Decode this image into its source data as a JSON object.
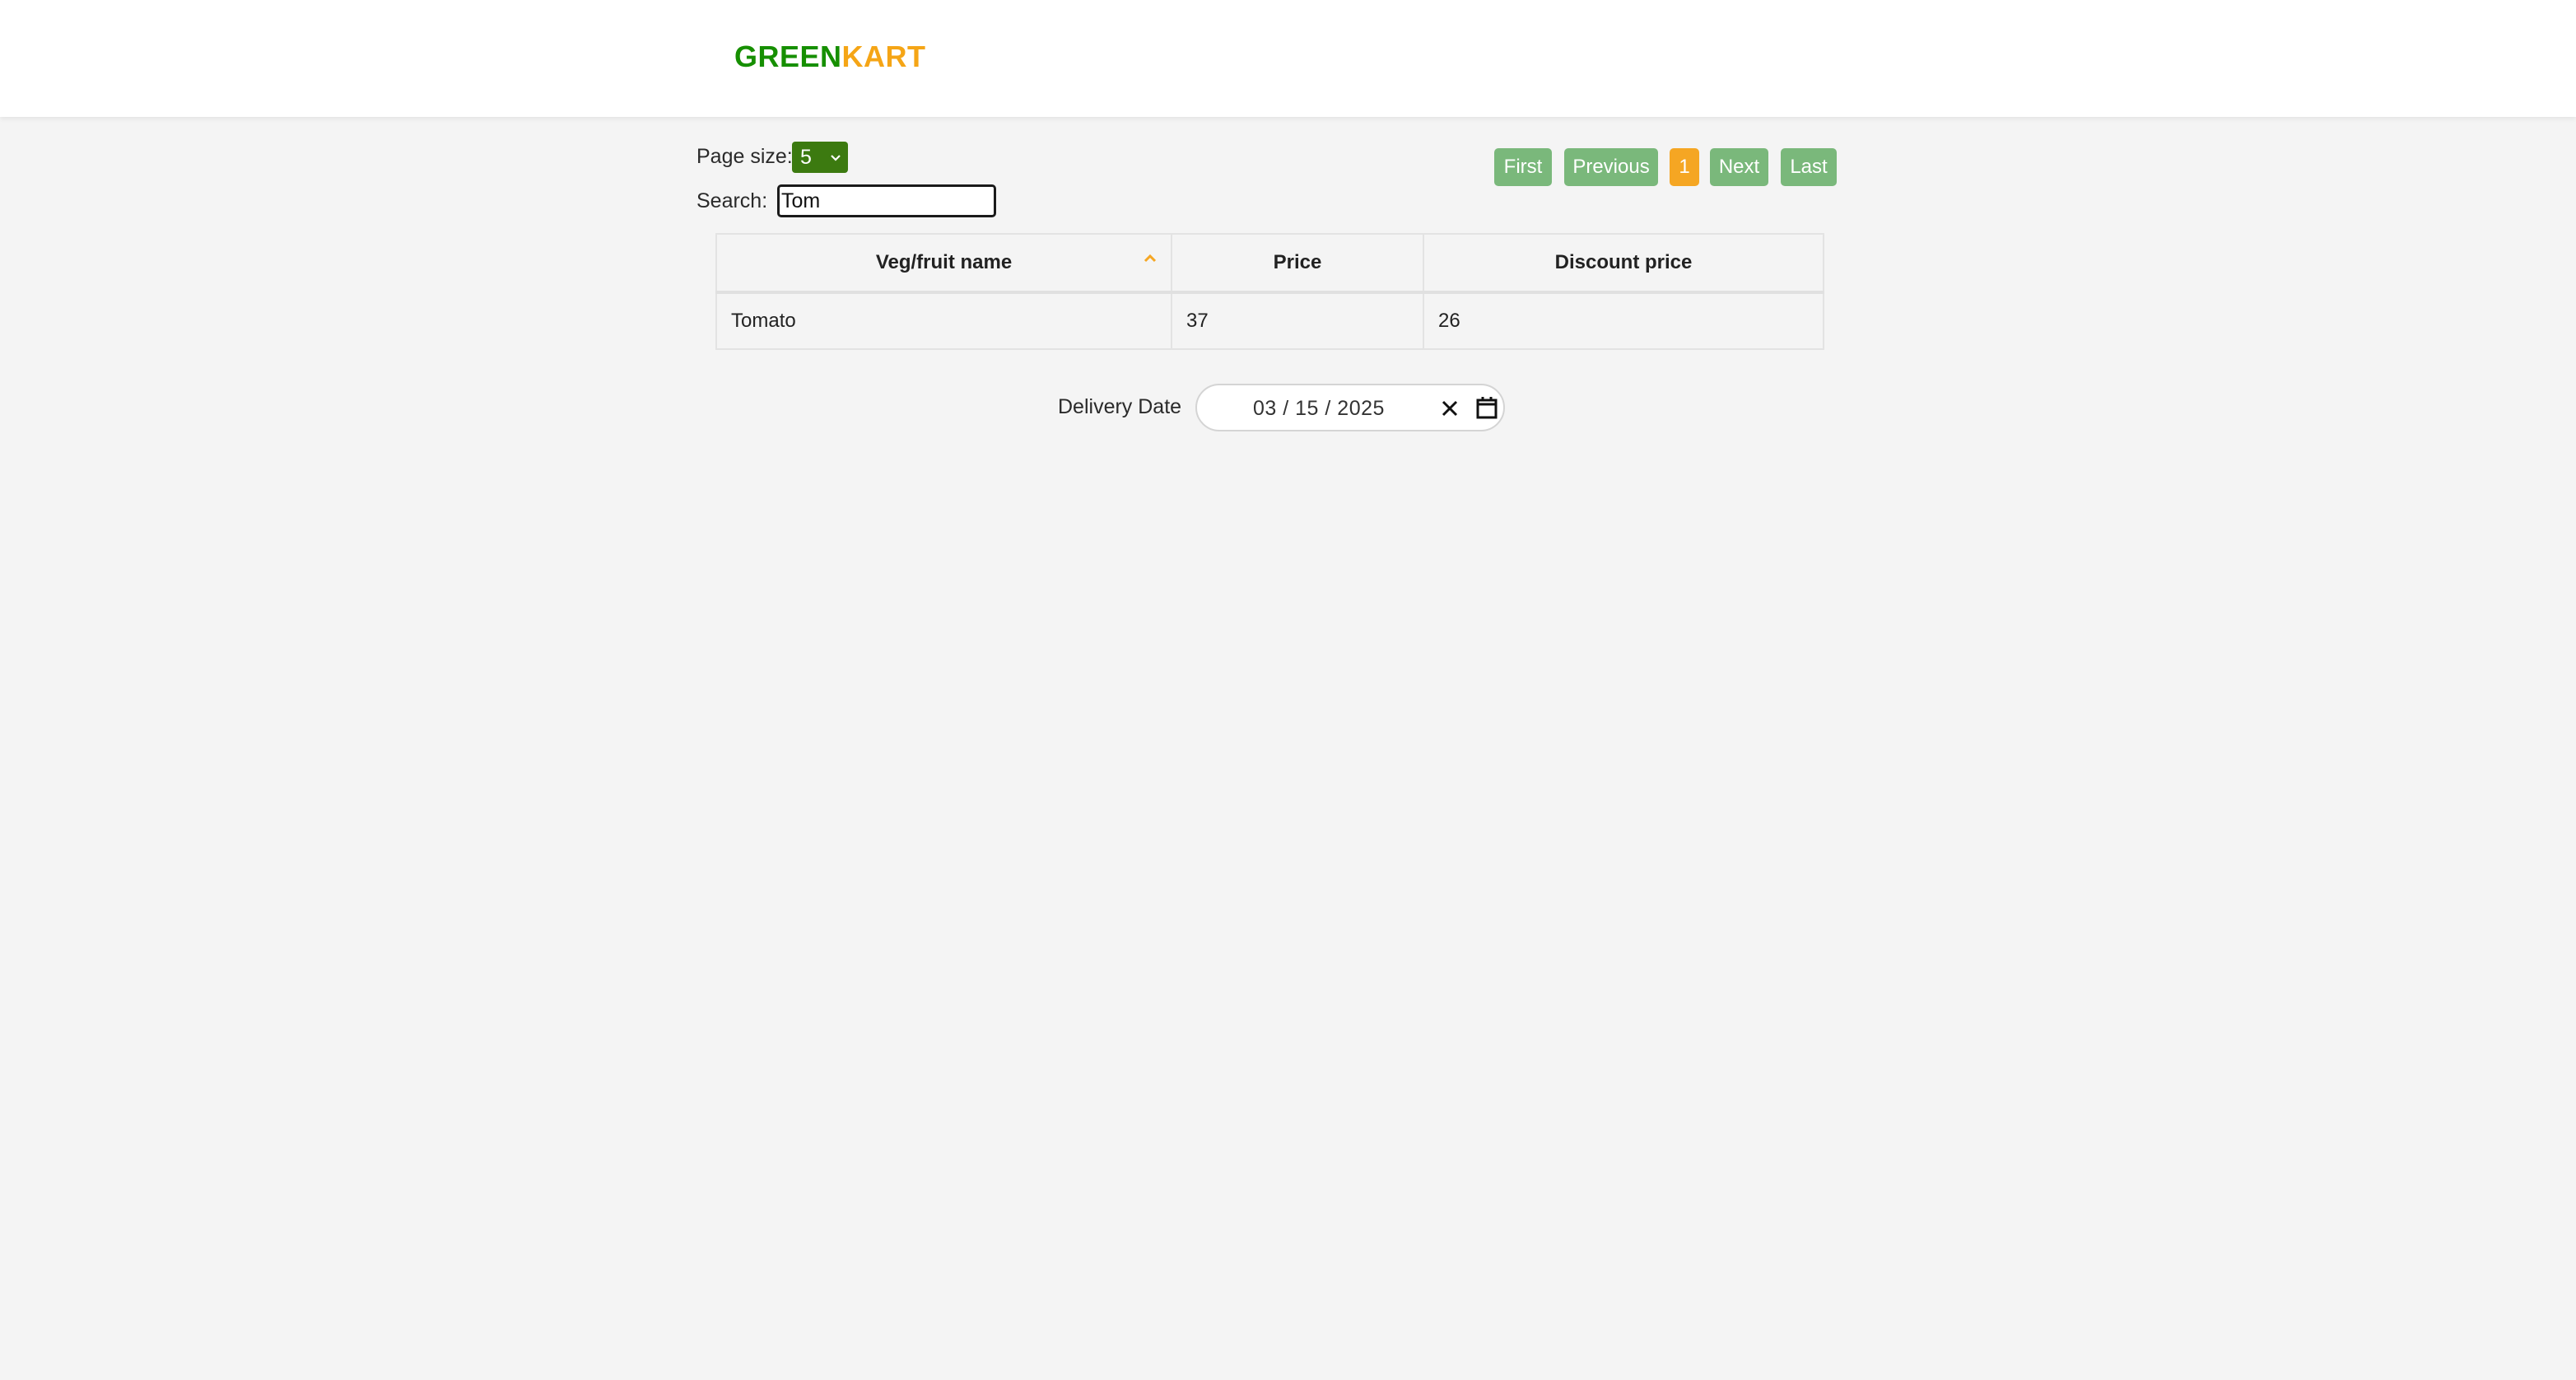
{
  "brand": {
    "part1": "GREEN",
    "part2": "KART"
  },
  "controls": {
    "page_size_label": "Page size:",
    "page_size_value": "5",
    "search_label": "Search:",
    "search_value": "Tom"
  },
  "pagination": {
    "first": "First",
    "previous": "Previous",
    "current": "1",
    "next": "Next",
    "last": "Last"
  },
  "table": {
    "headers": [
      "Veg/fruit name",
      "Price",
      "Discount price"
    ],
    "sort": "ascending on Veg/fruit name",
    "rows": [
      [
        "Tomato",
        "37",
        "26"
      ]
    ]
  },
  "delivery": {
    "label": "Delivery Date",
    "date": "03 / 15 / 2025"
  },
  "colors": {
    "brand_green": "#168f00",
    "brand_orange": "#f5a516",
    "pager_button": "#7ab87b",
    "pager_active": "#f5a623",
    "select_bg": "#3c7a10"
  },
  "icons": {
    "page_size_select": "chevron-down-icon",
    "sort_indicator": "chevron-up-icon",
    "date_clear": "close-icon",
    "date_picker": "calendar-icon"
  }
}
